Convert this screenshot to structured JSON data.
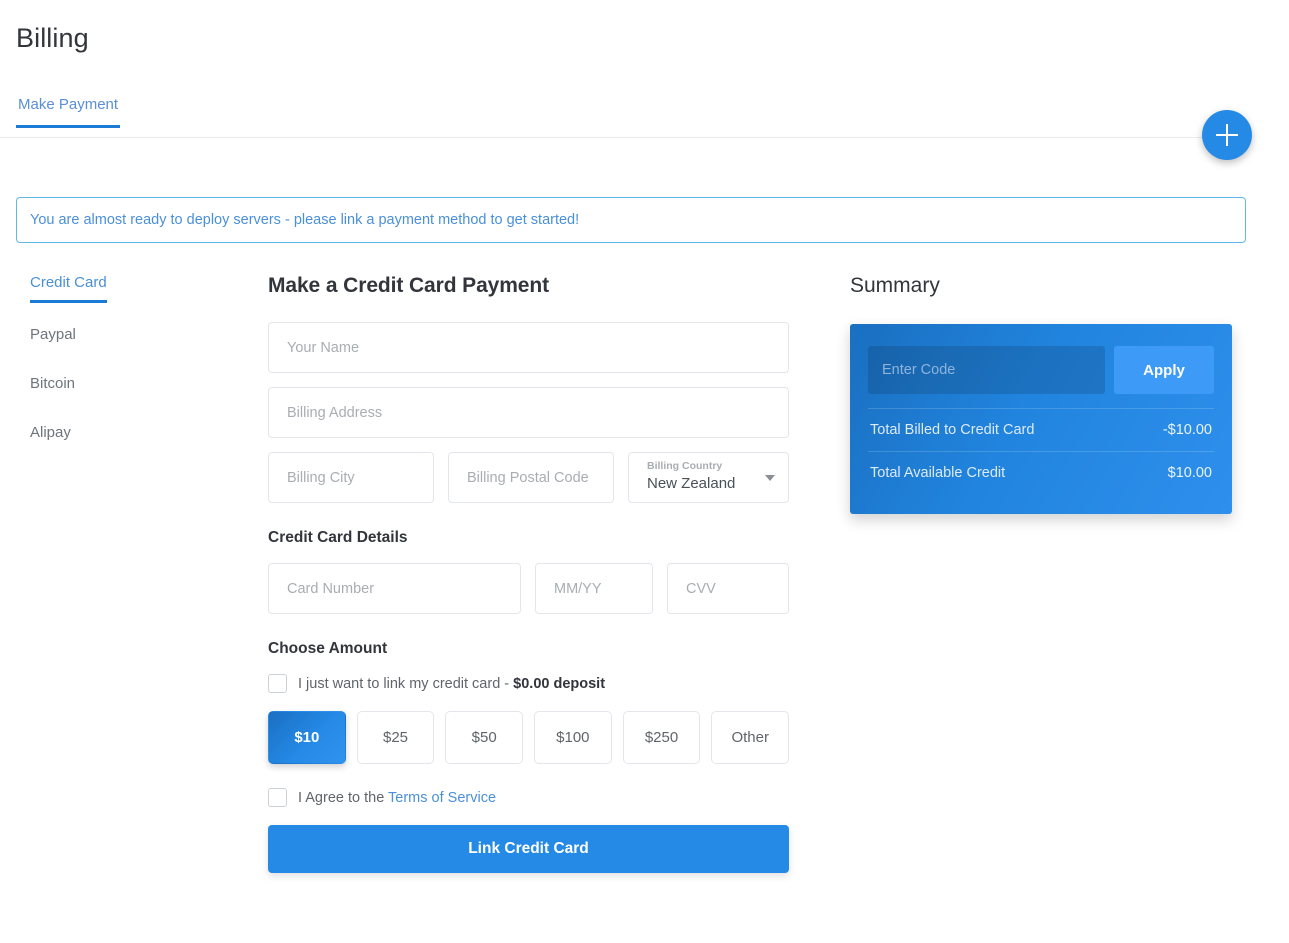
{
  "header": {
    "title": "Billing",
    "tabs": [
      {
        "label": "Make Payment",
        "active": true
      }
    ],
    "fab_icon": "plus-icon"
  },
  "banner": {
    "message": "You are almost ready to deploy servers - please link a payment method to get started!"
  },
  "payment_methods": [
    {
      "label": "Credit Card",
      "active": true
    },
    {
      "label": "Paypal",
      "active": false
    },
    {
      "label": "Bitcoin",
      "active": false
    },
    {
      "label": "Alipay",
      "active": false
    }
  ],
  "form": {
    "heading": "Make a Credit Card Payment",
    "name_placeholder": "Your Name",
    "name_value": "",
    "address_placeholder": "Billing Address",
    "address_value": "",
    "city_placeholder": "Billing City",
    "city_value": "",
    "postal_placeholder": "Billing Postal Code",
    "postal_value": "",
    "country_label": "Billing Country",
    "country_value": "New Zealand",
    "card_details_heading": "Credit Card Details",
    "card_number_placeholder": "Card Number",
    "card_number_value": "",
    "expiry_placeholder": "MM/YY",
    "expiry_value": "",
    "cvv_placeholder": "CVV",
    "cvv_value": "",
    "choose_amount_heading": "Choose Amount",
    "link_only_text": "I just want to link my credit card - ",
    "link_only_amount": "$0.00 deposit",
    "link_only_checked": false,
    "amounts": [
      {
        "label": "$10",
        "selected": true
      },
      {
        "label": "$25",
        "selected": false
      },
      {
        "label": "$50",
        "selected": false
      },
      {
        "label": "$100",
        "selected": false
      },
      {
        "label": "$250",
        "selected": false
      },
      {
        "label": "Other",
        "selected": false
      }
    ],
    "agree_text": "I Agree to the ",
    "agree_link": "Terms of Service",
    "agree_checked": false,
    "submit_label": "Link Credit Card"
  },
  "summary": {
    "heading": "Summary",
    "code_placeholder": "Enter Code",
    "code_value": "",
    "apply_label": "Apply",
    "lines": [
      {
        "label": "Total Billed to Credit Card",
        "value": "-$10.00"
      },
      {
        "label": "Total Available Credit",
        "value": "$10.00"
      }
    ]
  },
  "colors": {
    "accent": "#2589e6",
    "accent_dark": "#1a7ad4",
    "link": "#4a90d9",
    "text": "#32353b",
    "muted": "#6c757d",
    "border": "#e3e6ea",
    "banner_border": "#5eb8e8"
  }
}
